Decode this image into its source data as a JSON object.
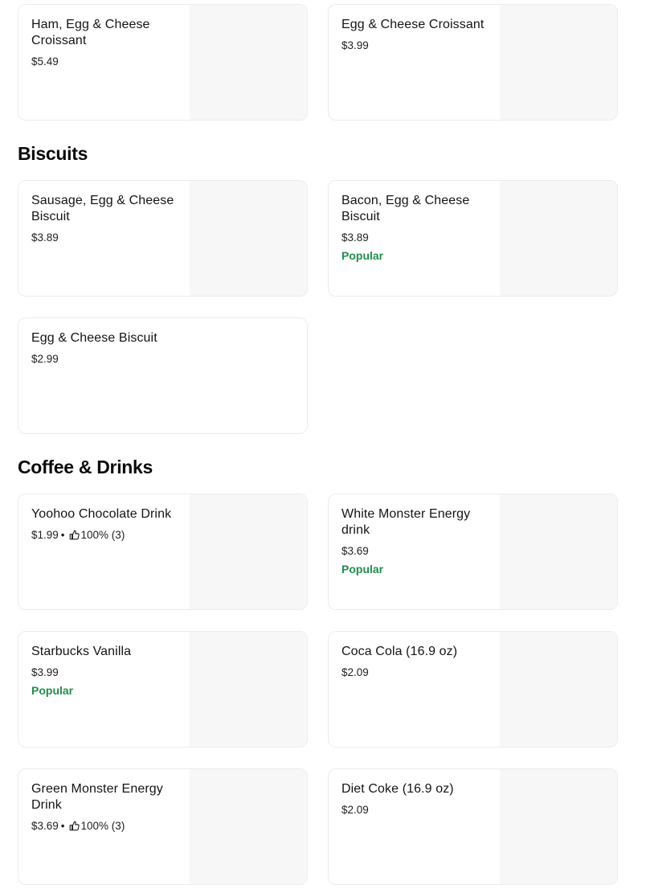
{
  "croissants": {
    "items": [
      {
        "name": "Ham, Egg & Cheese Croissant",
        "price": "$5.49"
      },
      {
        "name": "Egg & Cheese Croissant",
        "price": "$3.99"
      }
    ]
  },
  "biscuits": {
    "title": "Biscuits",
    "items": [
      {
        "name": "Sausage, Egg & Cheese Biscuit",
        "price": "$3.89"
      },
      {
        "name": "Bacon, Egg & Cheese Biscuit",
        "price": "$3.89",
        "badge": "Popular"
      },
      {
        "name": "Egg & Cheese Biscuit",
        "price": "$2.99"
      }
    ]
  },
  "drinks": {
    "title": "Coffee & Drinks",
    "items": [
      {
        "name": "Yoohoo Chocolate Drink",
        "price": "$1.99",
        "rating": "100% (3)"
      },
      {
        "name": "White Monster Energy drink",
        "price": "$3.69",
        "badge": "Popular"
      },
      {
        "name": "Starbucks Vanilla",
        "price": "$3.99",
        "badge": "Popular"
      },
      {
        "name": "Coca Cola (16.9 oz)",
        "price": "$2.09"
      },
      {
        "name": "Green Monster Energy Drink",
        "price": "$3.69",
        "rating": "100% (3)"
      },
      {
        "name": "Diet Coke (16.9 oz)",
        "price": "$2.09"
      }
    ]
  },
  "separator": "•",
  "icons": {
    "rating": "thumbs-up-icon"
  },
  "colors": {
    "popular": "#1e8f4a",
    "thumb_bg": "#f7f7f7",
    "border": "#ececec"
  }
}
